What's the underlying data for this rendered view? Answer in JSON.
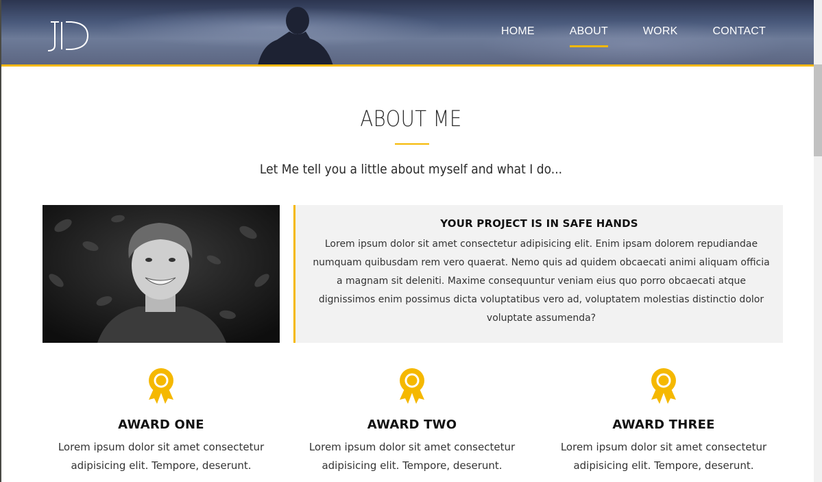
{
  "brand": {
    "logo_text": "JD"
  },
  "nav": {
    "items": [
      {
        "label": "HOME",
        "active": false
      },
      {
        "label": "ABOUT",
        "active": true
      },
      {
        "label": "WORK",
        "active": false
      },
      {
        "label": "CONTACT",
        "active": false
      }
    ]
  },
  "about": {
    "title": "ABOUT ME",
    "subtitle": "Let Me tell you a little about myself and what I do..."
  },
  "card": {
    "heading": "YOUR PROJECT IS IN SAFE HANDS",
    "body": "Lorem ipsum dolor sit amet consectetur adipisicing elit. Enim ipsam dolorem repudiandae numquam quibusdam rem vero quaerat. Nemo quis ad quidem obcaecati animi aliquam officia a magnam sit deleniti. Maxime consequuntur veniam eius quo porro obcaecati atque dignissimos enim possimus dicta voluptatibus vero ad, voluptatem molestias distinctio dolor voluptate assumenda?"
  },
  "awards": [
    {
      "title": "AWARD ONE",
      "text": "Lorem ipsum dolor sit amet consectetur adipisicing elit. Tempore, deserunt.",
      "icon": "award-medal-icon"
    },
    {
      "title": "AWARD TWO",
      "text": "Lorem ipsum dolor sit amet consectetur adipisicing elit. Tempore, deserunt.",
      "icon": "award-medal-icon"
    },
    {
      "title": "AWARD THREE",
      "text": "Lorem ipsum dolor sit amet consectetur adipisicing elit. Tempore, deserunt.",
      "icon": "award-medal-icon"
    }
  ],
  "colors": {
    "accent": "#f5b800",
    "card_bg": "#f2f2f2",
    "header_bg": "#4a5a7c"
  }
}
